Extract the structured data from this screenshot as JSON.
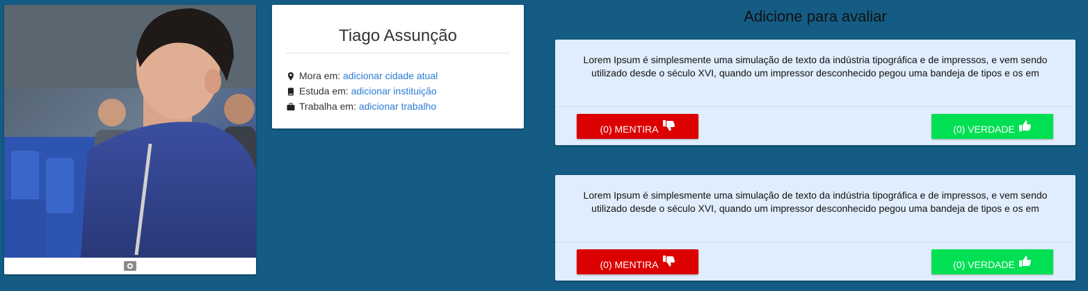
{
  "profile": {
    "name": "Tiago Assunção",
    "lives": {
      "label": "Mora em:",
      "link": "adicionar cidade atual"
    },
    "studies": {
      "label": "Estuda em:",
      "link": "adicionar instituição"
    },
    "works": {
      "label": "Trabalha em:",
      "link": "adicionar trabalho"
    }
  },
  "section": {
    "title": "Adicione para avaliar"
  },
  "cards": [
    {
      "text": "Lorem Ipsum é simplesmente uma simulação de texto da indústria tipográfica e de impressos, e vem sendo utilizado desde o século XVI, quando um impressor desconhecido pegou uma bandeja de tipos e os em",
      "lie_label": "(0) MENTIRA",
      "true_label": "(0) VERDADE"
    },
    {
      "text": "Lorem Ipsum é simplesmente uma simulação de texto da indústria tipográfica e de impressos, e vem sendo utilizado desde o século XVI, quando um impressor desconhecido pegou uma bandeja de tipos e os em",
      "lie_label": "(0) MENTIRA",
      "true_label": "(0) VERDADE"
    }
  ],
  "icons": {
    "location": "map-marker-icon",
    "study": "book-icon",
    "work": "briefcase-icon",
    "camera": "camera-icon",
    "lie": "thumbs-down-icon",
    "true": "thumbs-up-icon"
  },
  "colors": {
    "background": "#145c84",
    "card_light": "#e0edfc",
    "lie_button": "#dd0000",
    "true_button": "#00e052",
    "link": "#2a7bd6"
  }
}
